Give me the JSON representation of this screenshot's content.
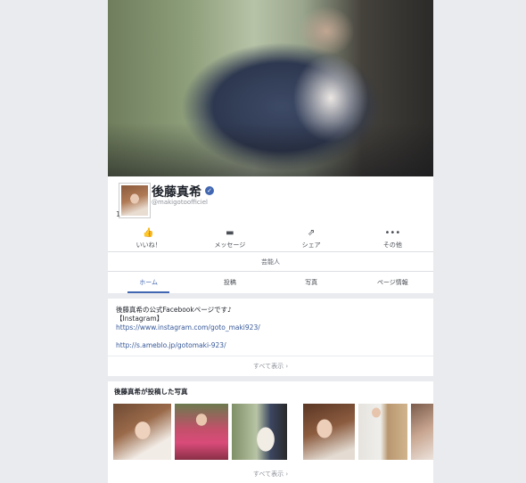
{
  "profile": {
    "name": "後藤真希",
    "handle": "@makigotoofficiel",
    "note": "1"
  },
  "actions": [
    {
      "icon": "like-icon",
      "glyph": "👍",
      "label": "いいね！"
    },
    {
      "icon": "message-icon",
      "glyph": "▬",
      "label": "メッセージ"
    },
    {
      "icon": "share-icon",
      "glyph": "⇗",
      "label": "シェア"
    },
    {
      "icon": "more-icon",
      "glyph": "•••",
      "label": "その他"
    }
  ],
  "category": "芸能人",
  "tabs": [
    {
      "label": "ホーム",
      "active": true
    },
    {
      "label": "投稿",
      "active": false
    },
    {
      "label": "写真",
      "active": false
    },
    {
      "label": "ページ情報",
      "active": false
    }
  ],
  "about": {
    "line1": "後藤真希の公式Facebookページです♪",
    "line2": "【Instagram】",
    "link1": "https://www.instagram.com/goto_maki923/",
    "link2": "http://s.ameblo.jp/gotomaki-923/",
    "see_all": "すべて表示 ›"
  },
  "photos": {
    "heading": "後藤真希が投稿した写真",
    "see_all": "すべて表示 ›"
  },
  "colors": {
    "accent": "#4267b2",
    "link": "#365899",
    "background": "#e9ebee"
  }
}
